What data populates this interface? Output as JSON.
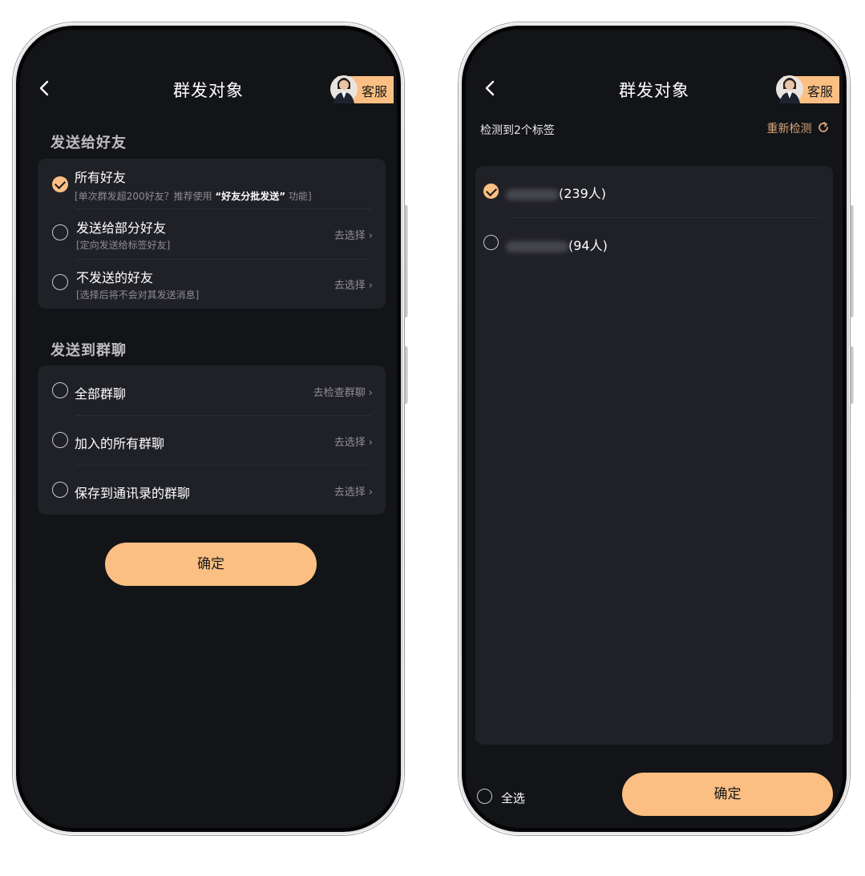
{
  "left": {
    "title": "群发对象",
    "customer_service": "客服",
    "friends_section": "发送给好友",
    "friends_options": [
      {
        "title": "所有好友",
        "sub_prefix": "[单次群发超200好友？推荐使用",
        "sub_highlight": "“好友分批发送”",
        "sub_suffix": "功能]",
        "checked": true
      },
      {
        "title": "发送给部分好友",
        "sub": "[定向发送给标签好友]",
        "action": "去选择"
      },
      {
        "title": "不发送的好友",
        "sub": "[选择后将不会对其发送消息]",
        "action": "去选择"
      }
    ],
    "groups_section": "发送到群聊",
    "group_options": [
      {
        "title": "全部群聊",
        "action": "去检查群聊"
      },
      {
        "title": "加入的所有群聊",
        "action": "去选择"
      },
      {
        "title": "保存到通讯录的群聊",
        "action": "去选择"
      }
    ],
    "confirm": "确定"
  },
  "right": {
    "title": "群发对象",
    "customer_service": "客服",
    "detect_text": "检测到2个标签",
    "redetect": "重新检测",
    "tags": [
      {
        "count": "(239人)",
        "checked": true
      },
      {
        "count": "(94人)",
        "checked": false
      }
    ],
    "select_all": "全选",
    "confirm": "确定"
  },
  "colors": {
    "accent": "#fbbf83",
    "screen_bg": "#131418",
    "card_bg": "#202126"
  },
  "icons": [
    "back-arrow-icon",
    "avatar-icon",
    "check-icon",
    "chevron-right-icon",
    "refresh-icon"
  ]
}
